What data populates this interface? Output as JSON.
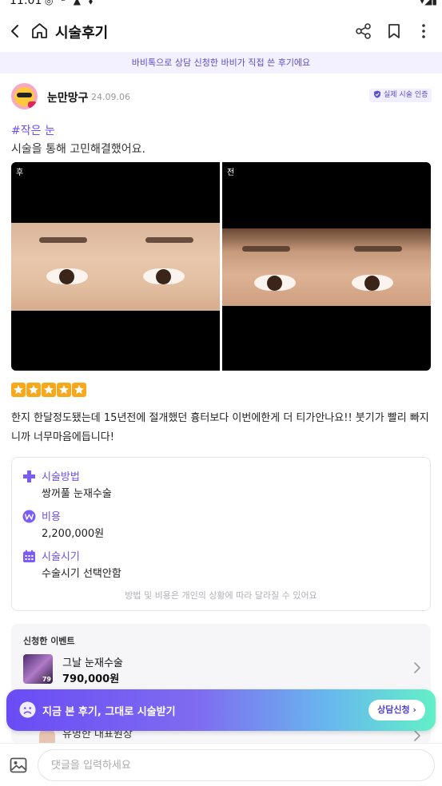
{
  "status_bar": {
    "time": "11:01",
    "left_icons": "◎ ᙆ ▲ ⬧",
    "right_icons": "▾◢▮"
  },
  "header": {
    "title": "시술후기"
  },
  "notice": {
    "text": "바비톡으로 상담 신청한 바비가 직접 쓴 후기에요"
  },
  "author": {
    "name": "눈만망구",
    "date": "24.09.06",
    "badge": "실제 시술 인증"
  },
  "review": {
    "hashtag": "#작은 눈",
    "lead": "시술을 통해 고민해결했어요.",
    "photos": [
      {
        "label": "후"
      },
      {
        "label": "전"
      }
    ],
    "rating": 5,
    "body": "한지 한달정도됐는데 15년전에 절개했던 흉터보다 이번에한게 더 티가안나요!! 붓기가 빨리 빠지니까 너무마음에듭니다!"
  },
  "info": {
    "method_label": "시술방법",
    "method_value": "쌍꺼풀 눈재수술",
    "cost_label": "비용",
    "cost_value": "2,200,000원",
    "date_label": "시술시기",
    "date_value": "수술시기 선택안함",
    "note": "방법 및 비용은 개인의 상황에 따라 달라질 수 있어요"
  },
  "event": {
    "heading": "신청한 이벤트",
    "items": [
      {
        "name": "그날 눈재수술",
        "price": "790,000원",
        "thumb_text": "79"
      },
      {
        "name": "유명한 대표원장"
      }
    ]
  },
  "cta": {
    "text": "지금 본 후기, 그대로 시술받기",
    "button": "상담신청 ›"
  },
  "comment": {
    "placeholder": "댓글을 입력하세요"
  },
  "colors": {
    "accent": "#6b4ff3",
    "star": "#f7a81b",
    "notice_bg": "#f3f1ff"
  }
}
